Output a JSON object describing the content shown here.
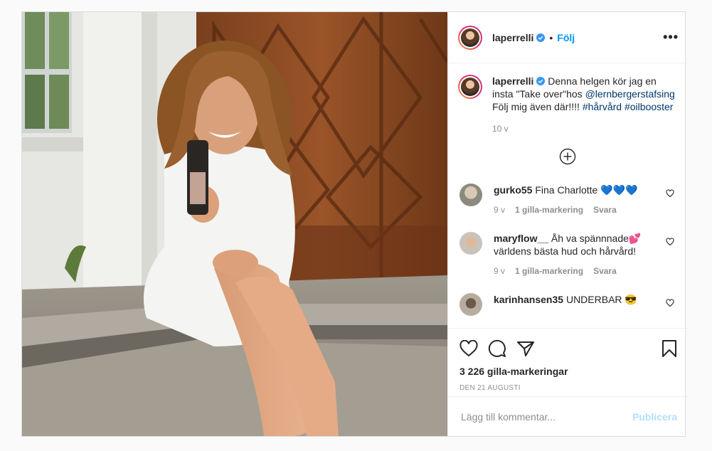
{
  "post": {
    "username": "laperrelli",
    "dot": "•",
    "follow_label": "Följ",
    "more_label": "•••"
  },
  "caption": {
    "username": "laperrelli",
    "text_part1": " Denna helgen kör jag en insta \"Take over\"hos ",
    "mention": "@lernbergerstafsing",
    "text_part2": " Följ mig även där!!!! ",
    "hashtag1": "#hårvård",
    "hashtag2": "#oilbooster",
    "time": "10 v"
  },
  "comments": [
    {
      "username": "gurko55",
      "text": " Fina Charlotte 💙💙💙",
      "time": "9 v",
      "likes": "1 gilla-markering",
      "reply": "Svara"
    },
    {
      "username": "maryflow__",
      "text": " Åh va spännnade💕 världens bästa hud och hårvård!",
      "time": "9 v",
      "likes": "1 gilla-markering",
      "reply": "Svara"
    },
    {
      "username": "karinhansen35",
      "text": " UNDERBAR 😎"
    }
  ],
  "likes_count": "3 226 gilla-markeringar",
  "date": "DEN 21 AUGUSTI",
  "add_comment": {
    "placeholder": "Lägg till kommentar...",
    "publish_label": "Publicera"
  },
  "colors": {
    "link_blue": "#0095f6",
    "publish_disabled": "#b2dffc",
    "muted": "#8e8e8e"
  },
  "icons": [
    "verified-badge-icon",
    "more-options-icon",
    "load-more-icon",
    "heart-icon",
    "comment-icon",
    "share-icon",
    "bookmark-icon"
  ]
}
